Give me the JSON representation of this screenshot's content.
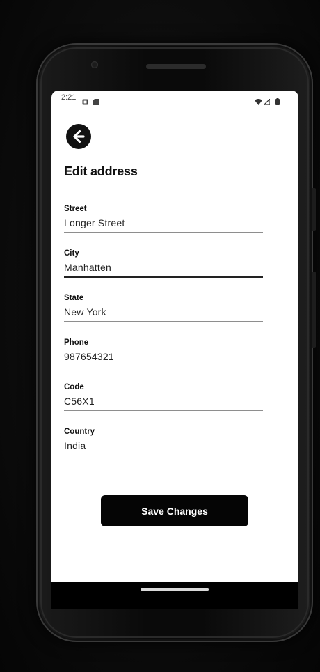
{
  "status_bar": {
    "time": "2:21",
    "icons": [
      "notification-icon",
      "sd-card-icon",
      "wifi-icon",
      "signal-icon",
      "battery-icon"
    ]
  },
  "header": {
    "back_icon": "arrow-left-icon",
    "title": "Edit address"
  },
  "form": {
    "fields": [
      {
        "label": "Street",
        "value": "Longer Street"
      },
      {
        "label": "City",
        "value": "Manhatten"
      },
      {
        "label": "State",
        "value": "New York"
      },
      {
        "label": "Phone",
        "value": "987654321"
      },
      {
        "label": "Code",
        "value": "C56X1"
      },
      {
        "label": "Country",
        "value": "India"
      }
    ]
  },
  "actions": {
    "save_label": "Save Changes"
  },
  "colors": {
    "primary": "#050505",
    "background": "#ffffff",
    "underline": "#8e8e8e"
  }
}
